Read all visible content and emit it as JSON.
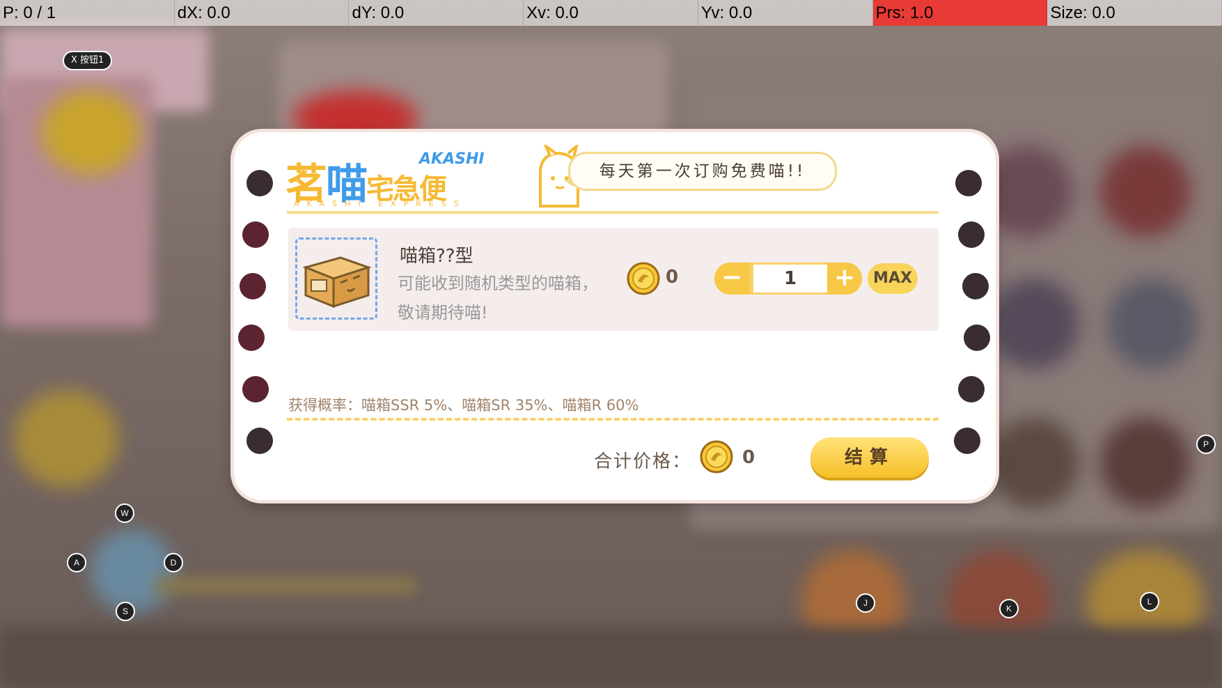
{
  "debug": {
    "pointer": "P: 0 / 1",
    "dx": "dX: 0.0",
    "dy": "dY: 0.0",
    "xv": "Xv: 0.0",
    "yv": "Yv: 0.0",
    "prs": "Prs: 1.0",
    "size": "Size: 0.0"
  },
  "overlay": {
    "x_button": "X 按钮1",
    "keys": {
      "w": "W",
      "a": "A",
      "s": "S",
      "d": "D",
      "j": "J",
      "k": "K",
      "l": "L",
      "p": "P"
    }
  },
  "dialog": {
    "logo_cn_yellow": "茗",
    "logo_cn_blue": "喵",
    "logo_cn_rest": "宅急便",
    "logo_akashi": "AKASHI",
    "logo_sub": "AKASHI EXPRESS",
    "speech": "每天第一次订购免费喵!!",
    "item": {
      "name": "喵箱??型",
      "desc_line1": "可能收到随机类型的喵箱，",
      "desc_line2": "敬请期待喵!",
      "price": "0",
      "quantity": "1",
      "minus": "−",
      "plus": "+",
      "max": "MAX"
    },
    "probability": "获得概率：喵箱SSR 5%、喵箱SR 35%、喵箱R 60%",
    "total_label": "合计价格：",
    "total_value": "0",
    "checkout": "结算"
  },
  "colors": {
    "accent_yellow": "#f6c028",
    "accent_blue": "#3f9bea",
    "debug_alert": "#e83a36"
  }
}
